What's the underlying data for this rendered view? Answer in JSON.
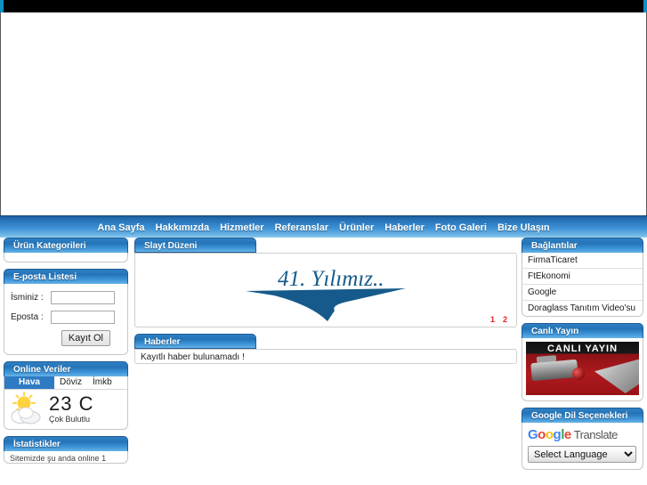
{
  "topbar": {
    "accent_color": "#0e8fc4",
    "bar_color": "#000000"
  },
  "nav": {
    "items": [
      {
        "label": "Ana Sayfa",
        "name": "nav-item-ana-sayfa"
      },
      {
        "label": "Hakkımızda",
        "name": "nav-item-hakkimizda"
      },
      {
        "label": "Hizmetler",
        "name": "nav-item-hizmetler"
      },
      {
        "label": "Referanslar",
        "name": "nav-item-referanslar"
      },
      {
        "label": "Ürünler",
        "name": "nav-item-urunler"
      },
      {
        "label": "Haberler",
        "name": "nav-item-haberler"
      },
      {
        "label": "Foto Galeri",
        "name": "nav-item-foto-galeri"
      },
      {
        "label": "Bize Ulaşın",
        "name": "nav-item-bize-ulasin"
      }
    ]
  },
  "sidebar_left": {
    "categories": {
      "title": "Ürün Kategorileri"
    },
    "mail_list": {
      "title": "E-posta Listesi",
      "name_label": "İsminiz :",
      "name_value": "",
      "name_placeholder": "",
      "email_label": "Eposta :",
      "email_value": "",
      "email_placeholder": "",
      "submit_label": "Kayıt Ol"
    },
    "online_data": {
      "title": "Online Veriler",
      "tabs": [
        {
          "label": "Hava",
          "active": true
        },
        {
          "label": "Döviz",
          "active": false
        },
        {
          "label": "İmkb",
          "active": false
        }
      ],
      "temperature": "23 C",
      "condition": "Çok Bulutlu",
      "icon": "sun-behind-cloud-icon"
    },
    "statistics": {
      "title": "İstatistikler",
      "line": "Sitemizde şu anda online 1"
    }
  },
  "main": {
    "slider": {
      "title": "Slayt Düzeni",
      "slide_caption": "41. Yılımız..",
      "logo_color": "#155a8a",
      "pages": [
        "1",
        "2"
      ],
      "pager_color": "#e2221b"
    },
    "news": {
      "title": "Haberler",
      "empty_message": "Kayıtlı haber bulunamadı !"
    }
  },
  "sidebar_right": {
    "links": {
      "title": "Bağlantılar",
      "items": [
        {
          "label": "FirmaTicaret"
        },
        {
          "label": "FtEkonomi"
        },
        {
          "label": "Google"
        },
        {
          "label": "Doraglass Tanıtım Video'su"
        }
      ]
    },
    "live": {
      "title": "Canlı Yayın",
      "banner_text": "CANLI YAYIN"
    },
    "translate": {
      "title": "Google Dil Seçenekleri",
      "logo_letters": [
        "G",
        "o",
        "o",
        "g",
        "l",
        "e"
      ],
      "logo_word": "Translate",
      "select_value": "Select Language",
      "options": [
        "Select Language"
      ]
    }
  }
}
